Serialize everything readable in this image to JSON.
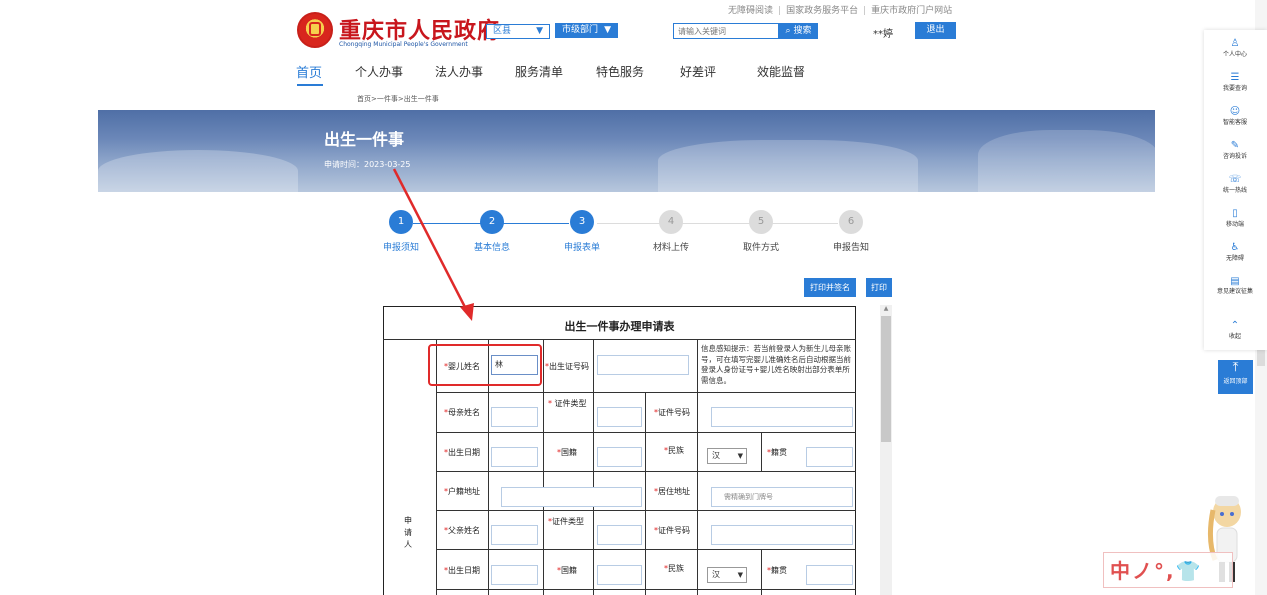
{
  "topbar": {
    "accessibility": "无障碍阅读",
    "national_platform": "国家政务服务平台",
    "portal": "重庆市政府门户网站",
    "separator": "|"
  },
  "header": {
    "site_title": "重庆市人民政府",
    "site_subtitle": "Chongqing Municipal People's Government",
    "district_select": "区县",
    "dept_select": "市级部门",
    "search_placeholder": "请输入关键词",
    "search_button": "搜索",
    "username": "**婷",
    "logout": "退出"
  },
  "nav": {
    "items": [
      "首页",
      "个人办事",
      "法人办事",
      "服务清单",
      "特色服务",
      "好差评",
      "效能监督"
    ]
  },
  "breadcrumb": "首页>一件事>出生一件事",
  "banner": {
    "title": "出生一件事",
    "date": "申请时间：2023-03-25"
  },
  "steps": [
    {
      "num": "1",
      "label": "申报须知",
      "status": "done"
    },
    {
      "num": "2",
      "label": "基本信息",
      "status": "done"
    },
    {
      "num": "3",
      "label": "申报表单",
      "status": "done"
    },
    {
      "num": "4",
      "label": "材料上传",
      "status": "todo"
    },
    {
      "num": "5",
      "label": "取件方式",
      "status": "todo"
    },
    {
      "num": "6",
      "label": "申报告知",
      "status": "todo"
    }
  ],
  "actions": {
    "print_sign": "打印并签名",
    "print": "打印"
  },
  "form": {
    "title": "出生一件事办理申请表",
    "required_mark": "*",
    "applicant_label": "申请人",
    "baby_name_label": "婴儿姓名",
    "baby_name_value": "林",
    "birth_cert_label": "出生证号码",
    "hint": "信息感知提示：若当前登录人为新生儿母亲账号，可在填写完婴儿准确姓名后自动根据当前登录人身份证号+婴儿姓名映射出部分表单所需信息。",
    "mother_name_label": "母亲姓名",
    "id_type_label": "证件类型",
    "id_number_label": "证件号码",
    "birth_date_label": "出生日期",
    "nationality_label": "国籍",
    "ethnicity_label": "民族",
    "ethnicity_value": "汉",
    "native_place_label": "籍贯",
    "household_address_label": "户籍地址",
    "residence_address_label": "居住地址",
    "residence_placeholder": "需精确到门牌号",
    "father_name_label": "父亲姓名",
    "father_id_type_label": "证件类型",
    "father_id_number_label": "证件号码",
    "father_birth_date_label": "出生日期",
    "father_nationality_label": "国籍",
    "father_ethnicity_label": "民族",
    "father_ethnicity_value": "汉",
    "father_native_place_label": "籍贯"
  },
  "sidebar": {
    "items": [
      {
        "label": "个人中心",
        "icon": "user-icon"
      },
      {
        "label": "我要查询",
        "icon": "query-icon"
      },
      {
        "label": "智能客服",
        "icon": "robot-icon"
      },
      {
        "label": "咨询投诉",
        "icon": "edit-icon"
      },
      {
        "label": "统一热线",
        "icon": "phone-icon"
      },
      {
        "label": "移动端",
        "icon": "mobile-icon"
      },
      {
        "label": "无障碍",
        "icon": "accessibility-icon"
      },
      {
        "label": "意见建议征集",
        "icon": "feedback-icon"
      },
      {
        "label": "收起",
        "icon": "chevron-up-icon"
      }
    ],
    "back_top": "返回顶部"
  },
  "watermark": "中ノ°,👕"
}
